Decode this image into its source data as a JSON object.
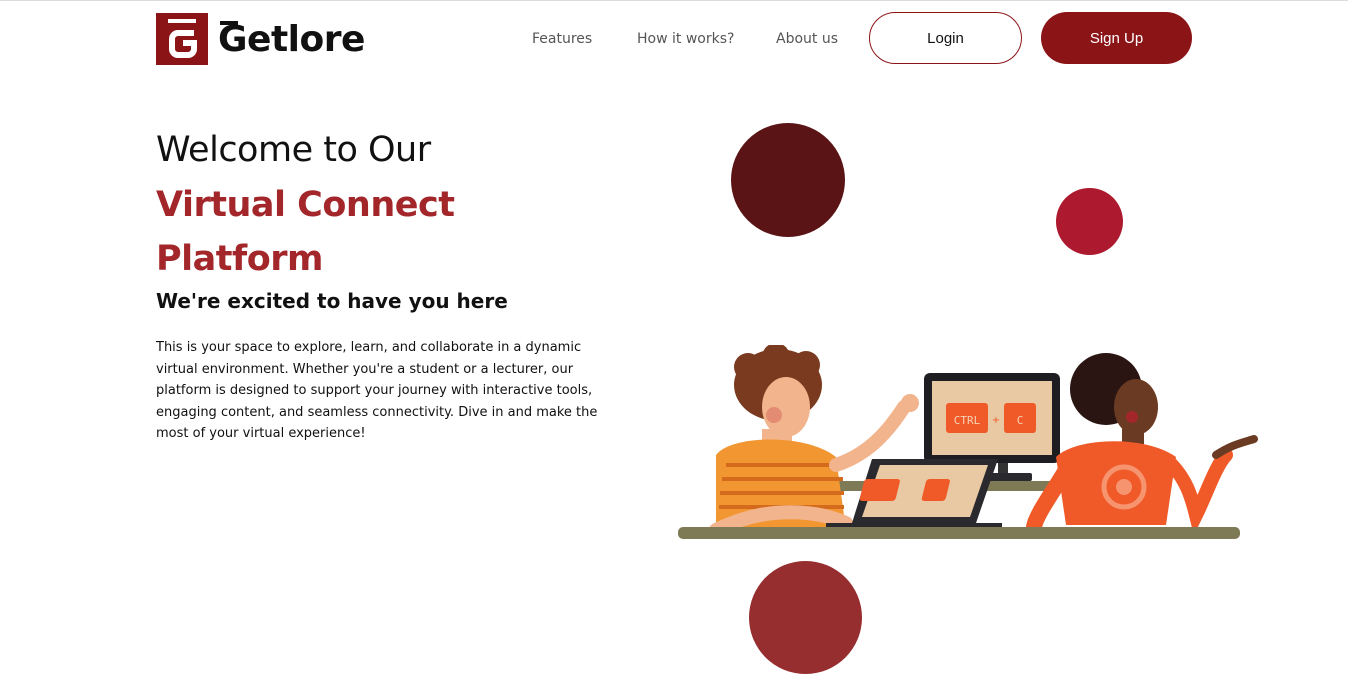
{
  "brand": {
    "name": "Getlore",
    "mark_letter": "G",
    "primary_color": "#8b1417",
    "accent_text_color": "#a3272a"
  },
  "nav": {
    "links": [
      "Features",
      "How it works?",
      "About us"
    ],
    "login_label": "Login",
    "signup_label": "Sign Up"
  },
  "hero": {
    "line1": "Welcome to Our",
    "line2": "Virtual Connect",
    "line3": "Platform",
    "subtitle": "We're excited to have you here",
    "body": "This is your space to explore, learn, and collaborate in a dynamic virtual environment. Whether you're a student or a lecturer, our platform is designed to support your journey with interactive tools, engaging content, and seamless connectivity. Dive in and make the most of your virtual experience!"
  },
  "illustration": {
    "screen_key_1": "CTRL",
    "screen_key_plus": "+",
    "screen_key_2": "C"
  },
  "colors": {
    "circle_dark": "#5a1416",
    "circle_bright": "#ad1a2f",
    "circle_mid": "#962d2e"
  }
}
